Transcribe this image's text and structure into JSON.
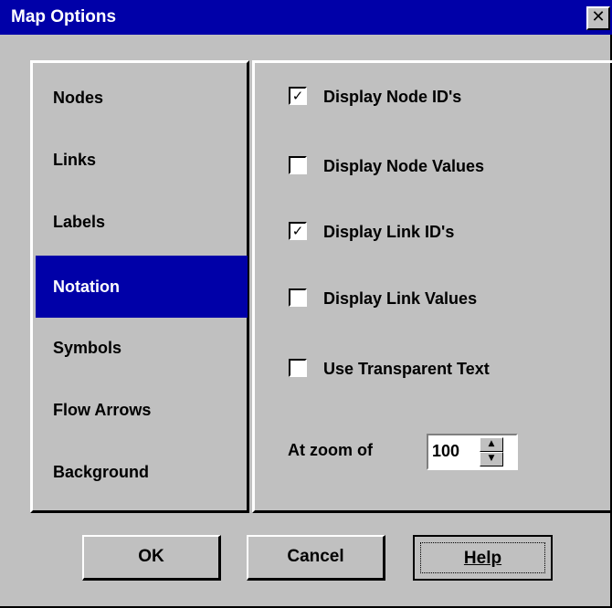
{
  "window": {
    "title": "Map Options",
    "close_glyph": "✕"
  },
  "sidebar": {
    "items": [
      {
        "label": "Nodes"
      },
      {
        "label": "Links"
      },
      {
        "label": "Labels"
      },
      {
        "label": "Notation",
        "selected": true
      },
      {
        "label": "Symbols"
      },
      {
        "label": "Flow Arrows"
      },
      {
        "label": "Background"
      }
    ]
  },
  "options": {
    "checkboxes": [
      {
        "label": "Display Node ID's",
        "checked": true
      },
      {
        "label": "Display Node Values",
        "checked": false
      },
      {
        "label": "Display Link ID's",
        "checked": true
      },
      {
        "label": "Display Link Values",
        "checked": false
      },
      {
        "label": "Use Transparent Text",
        "checked": false
      }
    ],
    "check_glyph": "✓",
    "zoom": {
      "label": "At zoom of",
      "value": "100",
      "up_glyph": "▲",
      "down_glyph": "▼"
    }
  },
  "buttons": {
    "ok": "OK",
    "cancel": "Cancel",
    "help": "Help"
  },
  "colors": {
    "selection": "#0000a8",
    "face": "#c0c0c0"
  }
}
